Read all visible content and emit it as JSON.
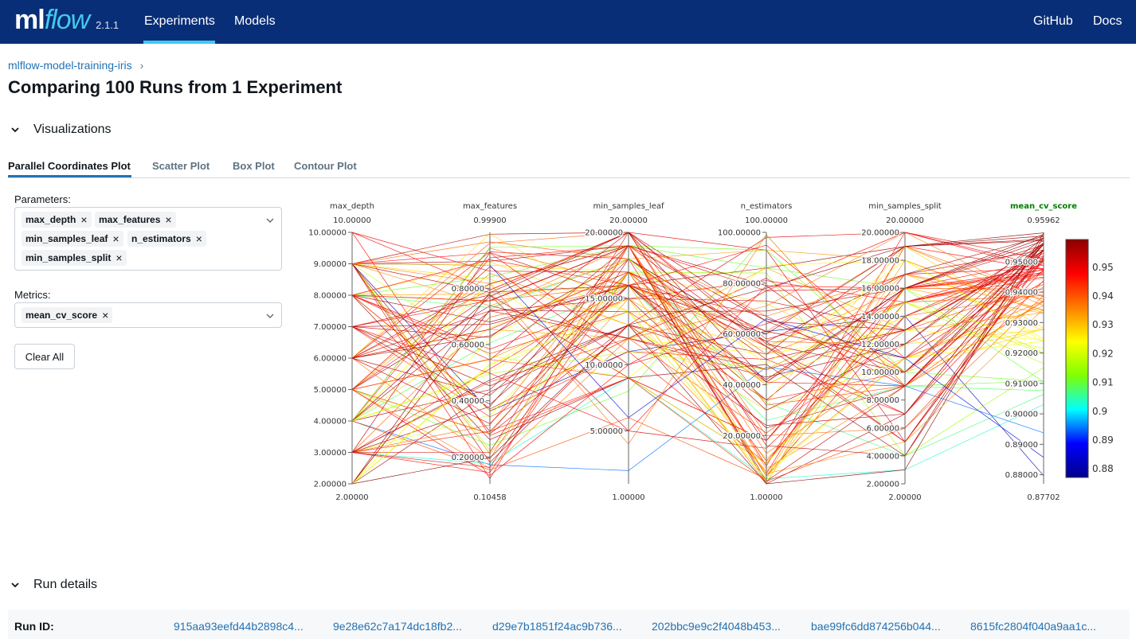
{
  "header": {
    "logo_ml": "ml",
    "logo_flow": "flow",
    "version": "2.1.1",
    "nav": [
      "Experiments",
      "Models"
    ],
    "right_nav": [
      "GitHub",
      "Docs"
    ]
  },
  "breadcrumb": {
    "experiment": "mlflow-model-training-iris",
    "separator": "›"
  },
  "page_title": "Comparing 100 Runs from 1 Experiment",
  "visualizations": {
    "title": "Visualizations",
    "tabs": [
      "Parallel Coordinates Plot",
      "Scatter Plot",
      "Box Plot",
      "Contour Plot"
    ],
    "active_tab": 0
  },
  "controls": {
    "parameters_label": "Parameters:",
    "parameters": [
      "max_depth",
      "max_features",
      "min_samples_leaf",
      "n_estimators",
      "min_samples_split"
    ],
    "metrics_label": "Metrics:",
    "metrics": [
      "mean_cv_score"
    ],
    "clear_all": "Clear All",
    "remove_glyph": "×"
  },
  "chart_data": {
    "type": "parallel_coordinates",
    "line_count": 100,
    "axes": [
      {
        "name": "max_depth",
        "max": "10.00000",
        "min": "2.00000",
        "ticks": [
          "10.00000",
          "9.00000",
          "8.00000",
          "7.00000",
          "6.00000",
          "5.00000",
          "4.00000",
          "3.00000",
          "2.00000"
        ],
        "tick_values": [
          10,
          9,
          8,
          7,
          6,
          5,
          4,
          3,
          2
        ],
        "range": [
          2,
          10
        ]
      },
      {
        "name": "max_features",
        "max": "0.99900",
        "min": "0.10458",
        "ticks": [
          "0.80000",
          "0.60000",
          "0.40000",
          "0.20000"
        ],
        "tick_values": [
          0.8,
          0.6,
          0.4,
          0.2
        ],
        "range": [
          0.10458,
          0.999
        ]
      },
      {
        "name": "min_samples_leaf",
        "max": "20.00000",
        "min": "1.00000",
        "ticks": [
          "20.00000",
          "15.00000",
          "10.00000",
          "5.00000"
        ],
        "tick_values": [
          20,
          15,
          10,
          5
        ],
        "range": [
          1,
          20
        ]
      },
      {
        "name": "n_estimators",
        "max": "100.00000",
        "min": "1.00000",
        "ticks": [
          "100.00000",
          "80.00000",
          "60.00000",
          "40.00000",
          "20.00000"
        ],
        "tick_values": [
          100,
          80,
          60,
          40,
          20
        ],
        "range": [
          1,
          100
        ]
      },
      {
        "name": "min_samples_split",
        "max": "20.00000",
        "min": "2.00000",
        "ticks": [
          "20.00000",
          "18.00000",
          "16.00000",
          "14.00000",
          "12.00000",
          "10.00000",
          "8.00000",
          "6.00000",
          "4.00000",
          "2.00000"
        ],
        "tick_values": [
          20,
          18,
          16,
          14,
          12,
          10,
          8,
          6,
          4,
          2
        ],
        "range": [
          2,
          20
        ]
      },
      {
        "name": "mean_cv_score",
        "max": "0.95962",
        "min": "0.87702",
        "highlight": true,
        "ticks": [
          "0.95000",
          "0.94000",
          "0.93000",
          "0.92000",
          "0.91000",
          "0.90000",
          "0.89000",
          "0.88000"
        ],
        "tick_values": [
          0.95,
          0.94,
          0.93,
          0.92,
          0.91,
          0.9,
          0.89,
          0.88
        ],
        "range": [
          0.87702,
          0.95962
        ]
      }
    ],
    "colorbar": {
      "range": [
        0.87702,
        0.95962
      ],
      "ticks": [
        "0.95",
        "0.94",
        "0.93",
        "0.92",
        "0.91",
        "0.9",
        "0.89",
        "0.88"
      ],
      "tick_values": [
        0.95,
        0.94,
        0.93,
        0.92,
        0.91,
        0.9,
        0.89,
        0.88
      ],
      "colorscale": [
        "#00008b",
        "#0000ff",
        "#00ffff",
        "#7fff00",
        "#ffff00",
        "#ff7f00",
        "#ff0000",
        "#8b0000"
      ]
    },
    "highlight_color": "#008000"
  },
  "run_details": {
    "title": "Run details",
    "run_id_label": "Run ID:",
    "run_ids": [
      "915aa93eefd44b2898c4...",
      "9e28e62c7a174dc18fb2...",
      "d29e7b1851f24ac9b736...",
      "202bbc9e9c2f4048b453...",
      "bae99fc6dd874256b044...",
      "8615fc2804f040a9aa1c..."
    ]
  },
  "colors": {
    "header_bg": "#082e77",
    "accent": "#43c9ed",
    "link": "#2272b4"
  }
}
